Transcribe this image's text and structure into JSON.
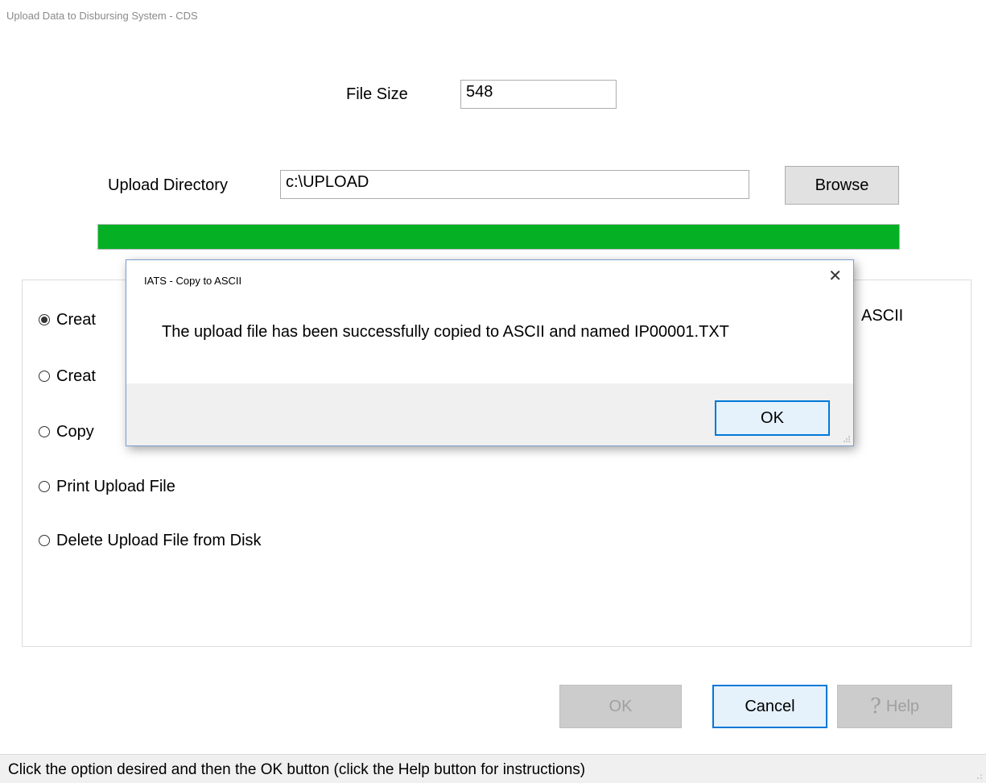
{
  "window": {
    "title": "Upload Data to Disbursing System - CDS"
  },
  "file_size": {
    "label": "File Size",
    "value": "548"
  },
  "upload_directory": {
    "label": "Upload Directory",
    "value": "c:\\UPLOAD",
    "browse_label": "Browse"
  },
  "progress": {
    "fraction": 1.0,
    "color": "#06b025"
  },
  "options": [
    {
      "label": "Creat",
      "selected": true
    },
    {
      "label": "Creat",
      "selected": false
    },
    {
      "label": "Copy",
      "selected": false
    },
    {
      "label": "Print Upload File",
      "selected": false
    },
    {
      "label": "Delete Upload File from Disk",
      "selected": false
    }
  ],
  "options_tail_text": "ASCII",
  "dialog": {
    "title": "IATS - Copy to ASCII",
    "close_icon": "close-icon",
    "message": "The upload file has been successfully copied to ASCII and named IP00001.TXT",
    "ok_label": "OK"
  },
  "buttons": {
    "ok_label": "OK",
    "cancel_label": "Cancel",
    "help_label": "Help",
    "help_icon": "?"
  },
  "status_bar": {
    "text": "Click the option desired and then the OK button (click the Help button for instructions)"
  }
}
